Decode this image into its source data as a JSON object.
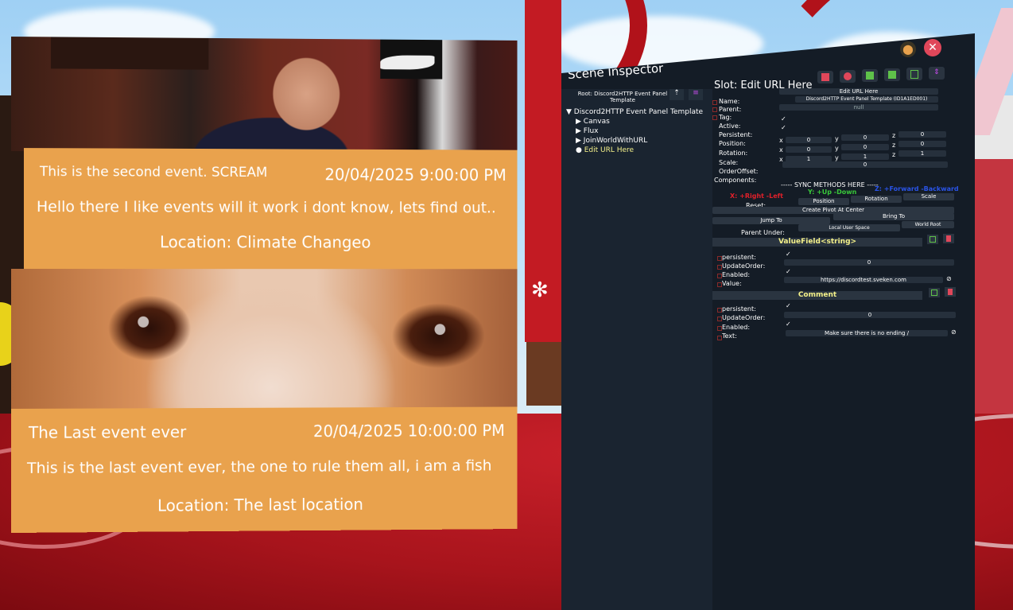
{
  "event_panel": {
    "events": [
      {
        "title": "This is the second event. SCREAM",
        "date": "20/04/2025 9:00:00 PM",
        "description": "Hello there I like events will it work i dont know, lets find out..",
        "location": "Location: Climate Changeo"
      },
      {
        "title": "The Last event ever",
        "date": "20/04/2025 10:00:00 PM",
        "description": "This is the last event ever, the one to rule them all, i am a fish",
        "location": "Location: The last location"
      }
    ],
    "accent_color": "#e9a24d"
  },
  "inspector": {
    "title": "Scene Inspector",
    "root_label": "Root: Discord2HTTP Event Panel Template",
    "slot_title": "Slot: Edit URL Here",
    "tree": [
      {
        "label": "Discord2HTTP Event Panel Template",
        "marker": "▼"
      },
      {
        "label": "Canvas",
        "marker": "▶"
      },
      {
        "label": "Flux",
        "marker": "▶"
      },
      {
        "label": "JoinWorldWithURL",
        "marker": "▶"
      },
      {
        "label": "Edit URL Here",
        "marker": "●"
      }
    ],
    "slot": {
      "name_label": "Name:",
      "name_value": "Edit URL Here",
      "parent_label": "Parent:",
      "parent_value": "Discord2HTTP Event Panel Template (ID1A1ED001)",
      "tag_label": "Tag:",
      "tag_value": "null",
      "active_label": "Active:",
      "active_value": "✓",
      "persistent_label": "Persistent:",
      "persistent_value": "✓",
      "position_label": "Position:",
      "position_values": [
        "0",
        "0",
        "0"
      ],
      "rotation_label": "Rotation:",
      "rotation_values": [
        "0",
        "0",
        "0"
      ],
      "scale_label": "Scale:",
      "scale_values": [
        "1",
        "1",
        "1"
      ],
      "axis_x": "x",
      "axis_y": "y",
      "axis_z": "z",
      "order_label": "OrderOffset:",
      "order_value": "0",
      "components_label": "Components:"
    },
    "sync_text": "----- SYNC METHODS HERE -----",
    "axis_hints": {
      "x": "X: +Right -Left",
      "y": "Y: +Up -Down",
      "z": "Z: +Forward -Backward"
    },
    "reset_label": "Reset:",
    "reset_buttons": [
      "Position",
      "Rotation",
      "Scale"
    ],
    "create_pivot": "Create Pivot At Center",
    "jump_to": "Jump To",
    "bring_to": "Bring To",
    "parent_under_label": "Parent Under:",
    "parent_under_buttons": [
      "Local User Space",
      "World Root"
    ],
    "valuefield": {
      "header": "ValueField<string>",
      "persistent_label": "persistent:",
      "persistent_value": "✓",
      "update_label": "UpdateOrder:",
      "update_value": "0",
      "enabled_label": "Enabled:",
      "enabled_value": "✓",
      "value_label": "Value:",
      "value_value": "https://discordtest.sveken.com"
    },
    "comment": {
      "header": "Comment",
      "persistent_label": "persistent:",
      "persistent_value": "✓",
      "update_label": "UpdateOrder:",
      "update_value": "0",
      "enabled_label": "Enabled:",
      "enabled_value": "✓",
      "text_label": "Text:",
      "text_value": "Make sure there is no ending /"
    },
    "colors": {
      "panel_bg": "#141c26",
      "header_text": "#f4f18a",
      "x_hint": "#e0202a",
      "y_hint": "#39c83a",
      "z_hint": "#2a54e8",
      "delete": "#e0475a",
      "add": "#5fc24a",
      "close": "#e0475a"
    }
  }
}
